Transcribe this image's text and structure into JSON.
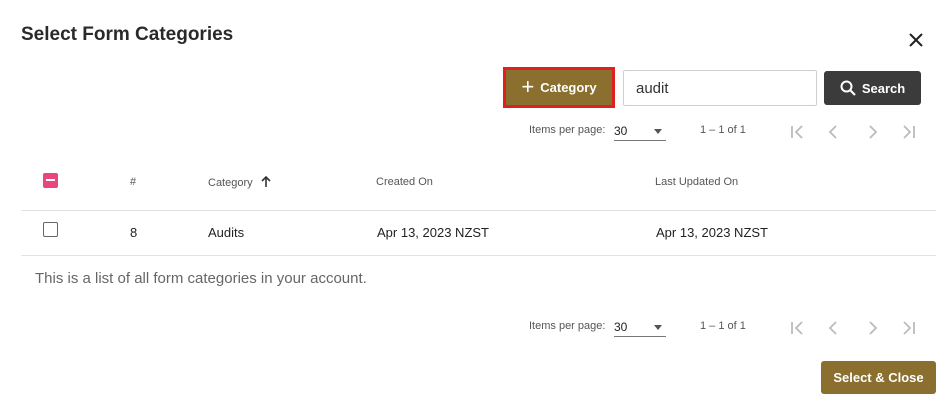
{
  "dialog": {
    "title": "Select Form Categories"
  },
  "toolbar": {
    "add_label": "Category",
    "search_value": "audit",
    "search_label": "Search"
  },
  "pager_top": {
    "items_per_page_label": "Items per page:",
    "page_size": "30",
    "range": "1 – 1 of 1"
  },
  "pager_bottom": {
    "items_per_page_label": "Items per page:",
    "page_size": "30",
    "range": "1 – 1 of 1"
  },
  "table": {
    "columns": [
      "#",
      "Category",
      "Created On",
      "Last Updated On"
    ],
    "rows": [
      {
        "num": "8",
        "category": "Audits",
        "created": "Apr 13, 2023 NZST",
        "updated": "Apr 13, 2023 NZST"
      }
    ]
  },
  "footnote": "This is a list of all form categories in your account.",
  "actions": {
    "select_close_label": "Select & Close"
  },
  "colors": {
    "accent": "#8a6f2e",
    "checkbox_indeterminate": "#e8467c",
    "highlight_border": "#e0201c",
    "dark_button": "#3b3b3b"
  }
}
